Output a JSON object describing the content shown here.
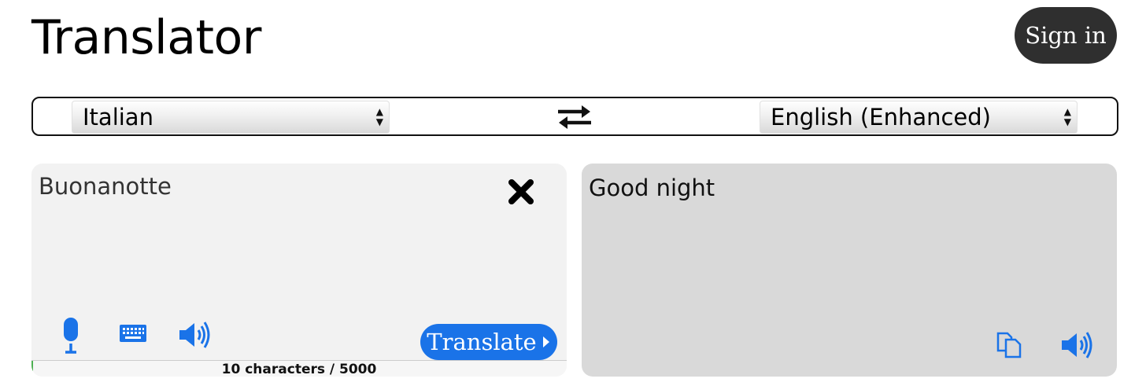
{
  "header": {
    "title": "Translator",
    "sign_in_label": "Sign in"
  },
  "languages": {
    "source": "Italian",
    "target": "English (Enhanced)"
  },
  "source": {
    "text": "Buonanotte"
  },
  "result": {
    "text": "Good night"
  },
  "actions": {
    "translate_label": "Translate"
  },
  "counter": {
    "text": "10 characters / 5000",
    "used": 10,
    "max": 5000
  },
  "colors": {
    "accent": "#1a73e8",
    "dark_button": "#2f2f2f",
    "progress": "#4caf50"
  },
  "icons": {
    "mic": "microphone-icon",
    "keyboard": "keyboard-icon",
    "speaker": "speaker-icon",
    "copy": "copy-icon",
    "clear": "close-icon",
    "swap": "swap-icon"
  }
}
